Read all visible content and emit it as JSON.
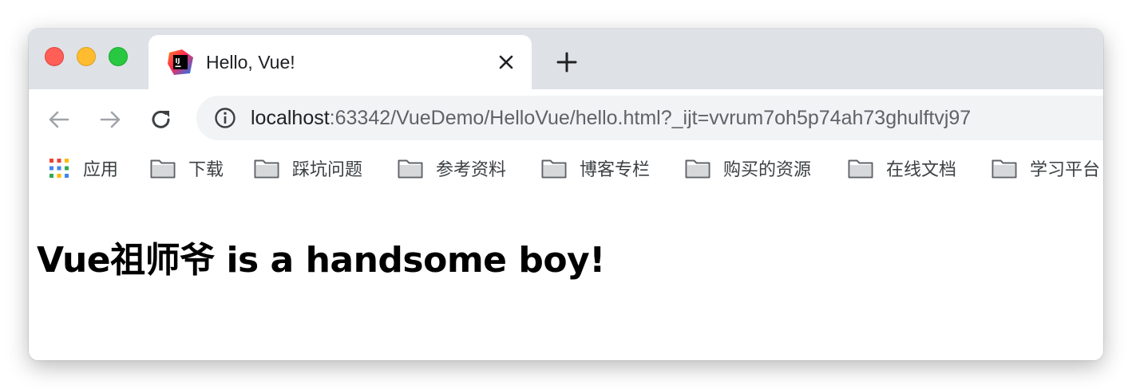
{
  "window": {
    "traffic_lights": {
      "close": "#ff5f57",
      "minimize": "#febc2e",
      "maximize": "#28c840"
    }
  },
  "tab": {
    "title": "Hello, Vue!",
    "favicon": "intellij-idea-icon"
  },
  "toolbar": {
    "url_host": "localhost",
    "url_rest": ":63342/VueDemo/HelloVue/hello.html?_ijt=vvrum7oh5p74ah73ghulftvj97"
  },
  "bookmarks": {
    "apps_label": "应用",
    "folders": [
      "下载",
      "踩坑问题",
      "参考资料",
      "博客专栏",
      "购买的资源",
      "在线文档",
      "学习平台"
    ]
  },
  "page": {
    "heading": "Vue祖师爷 is a handsome boy!"
  }
}
